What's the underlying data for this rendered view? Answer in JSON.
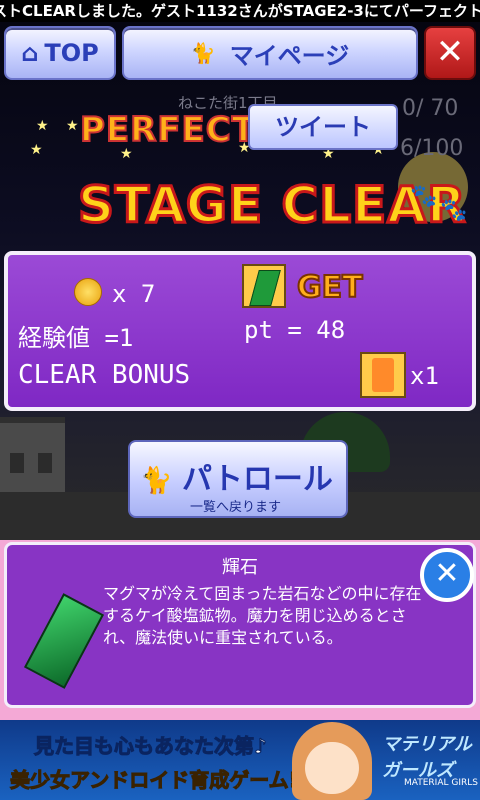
{
  "ticker": {
    "text": "ストCLEARしました。ゲスト1132さんがSTAGE2-3にてパーフェクト"
  },
  "header": {
    "top_label": "TOP",
    "mypage_label": "マイページ",
    "close_symbol": "✕"
  },
  "background": {
    "town_label": "ねこた街1丁目",
    "counter1": "0/ 70",
    "counter2": "6/100"
  },
  "result": {
    "perfect_label": "PERFECT",
    "tweet_label": "ツイート",
    "stage_clear_label": "STAGE CLEAR"
  },
  "rewards": {
    "coin_count": "x 7",
    "get_label": "GET",
    "exp_label": "経験値 =1",
    "pt_label": "pt = 48",
    "clear_bonus_label": "CLEAR BONUS",
    "bonus_count": "x1"
  },
  "patrol_button": {
    "label": "パトロール",
    "sublabel": "一覧へ戻ります"
  },
  "item_info": {
    "name": "輝石",
    "description": "マグマが冷えて固まった岩石などの中に存在するケイ酸塩鉱物。魔力を閉じ込めるとされ、魔法使いに重宝されている。",
    "close_symbol": "✕"
  },
  "ad": {
    "line1": "見た目も心もあなた次第♪",
    "line2": "美少女アンドロイド育成ゲーム!",
    "logo": "マテリアルガールズ",
    "logo_sub": "MATERIAL GIRLS"
  },
  "colors": {
    "panel": "#8a32c8",
    "accent_blue": "#2637b0",
    "close_red": "#c82020"
  }
}
